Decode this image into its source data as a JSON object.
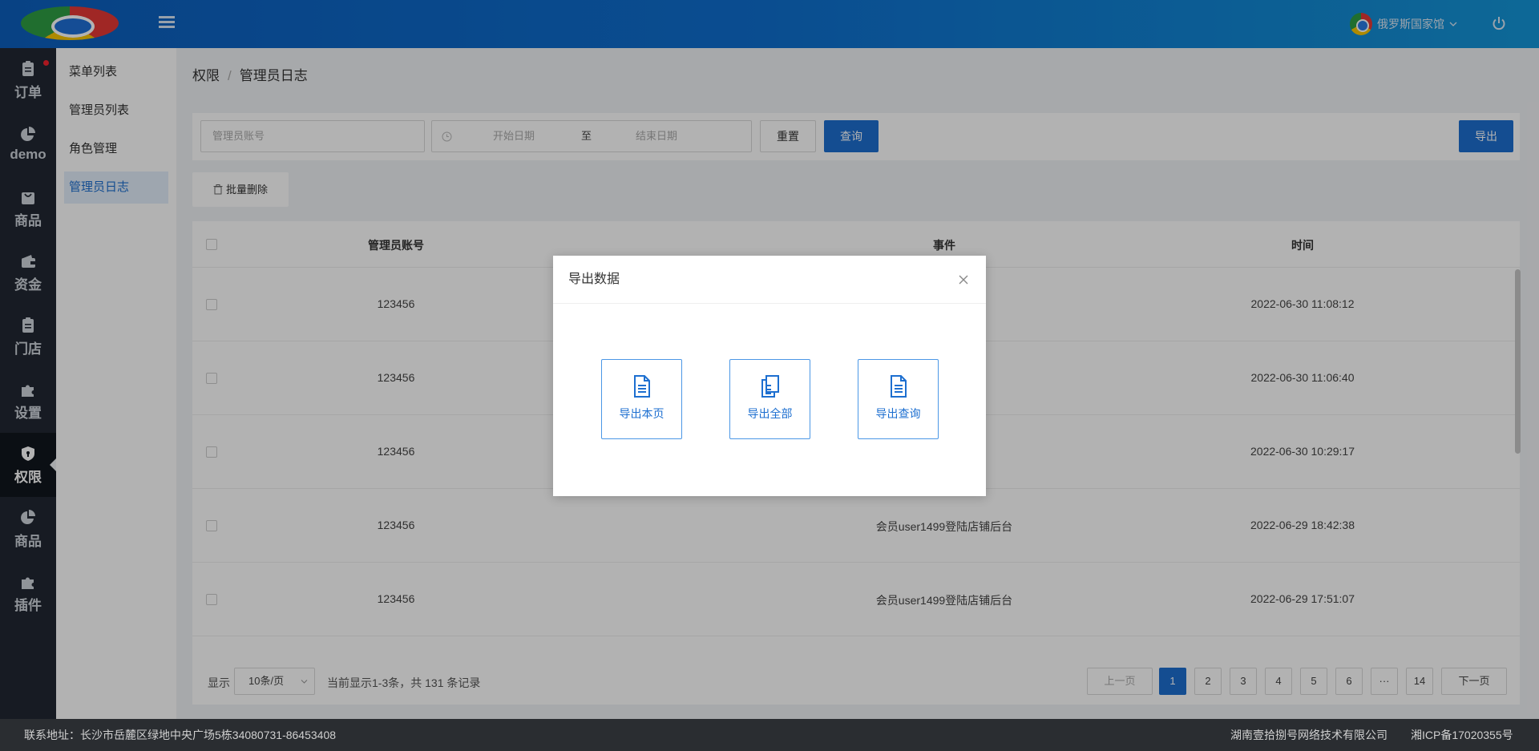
{
  "header": {
    "user_name": "俄罗斯国家馆"
  },
  "leftnav": {
    "items": [
      {
        "label": "订单",
        "icon": "clipboard-icon"
      },
      {
        "label": "demo",
        "icon": "pie-chart-icon"
      },
      {
        "label": "商品",
        "icon": "bag-icon"
      },
      {
        "label": "资金",
        "icon": "wallet-icon"
      },
      {
        "label": "门店",
        "icon": "clipboard-icon"
      },
      {
        "label": "设置",
        "icon": "puzzle-icon"
      },
      {
        "label": "权限",
        "icon": "shield-icon"
      },
      {
        "label": "商品",
        "icon": "pie-chart-icon"
      },
      {
        "label": "插件",
        "icon": "puzzle-icon"
      }
    ]
  },
  "subnav": {
    "items": [
      "菜单列表",
      "管理员列表",
      "角色管理",
      "管理员日志"
    ]
  },
  "breadcrumb": {
    "parent": "权限",
    "current": "管理员日志"
  },
  "filter": {
    "account_placeholder": "管理员账号",
    "start_date_placeholder": "开始日期",
    "date_separator": "至",
    "end_date_placeholder": "结束日期",
    "reset_label": "重置",
    "query_label": "查询",
    "export_label": "导出"
  },
  "toolbar": {
    "batch_delete_label": "批量删除"
  },
  "table": {
    "columns": [
      "管理员账号",
      "事件",
      "时间"
    ],
    "rows": [
      {
        "account": "123456",
        "event": "",
        "time": "2022-06-30 11:08:12"
      },
      {
        "account": "123456",
        "event": "",
        "time": "2022-06-30 11:06:40"
      },
      {
        "account": "123456",
        "event": "",
        "time": "2022-06-30 10:29:17"
      },
      {
        "account": "123456",
        "event": "会员user1499登陆店铺后台",
        "time": "2022-06-29 18:42:38"
      },
      {
        "account": "123456",
        "event": "会员user1499登陆店铺后台",
        "time": "2022-06-29 17:51:07"
      }
    ]
  },
  "pagination": {
    "show_label": "显示",
    "page_size": "10条/页",
    "summary": "当前显示1-3条，共 131 条记录",
    "prev_label": "上一页",
    "pages": [
      "1",
      "2",
      "3",
      "4",
      "5",
      "6",
      "···",
      "14"
    ],
    "current_page": "1",
    "next_label": "下一页"
  },
  "footer": {
    "address": "联系地址：长沙市岳麓区绿地中央广场5栋34080731-86453408",
    "company": "湖南壹拾捌号网络技术有限公司",
    "icp": "湘ICP备17020355号"
  },
  "modal": {
    "title": "导出数据",
    "options": [
      "导出本页",
      "导出全部",
      "导出查询"
    ]
  },
  "colors": {
    "primary": "#1d6fd0",
    "sidebar": "#212833",
    "topbar": "#0f6fcf"
  }
}
